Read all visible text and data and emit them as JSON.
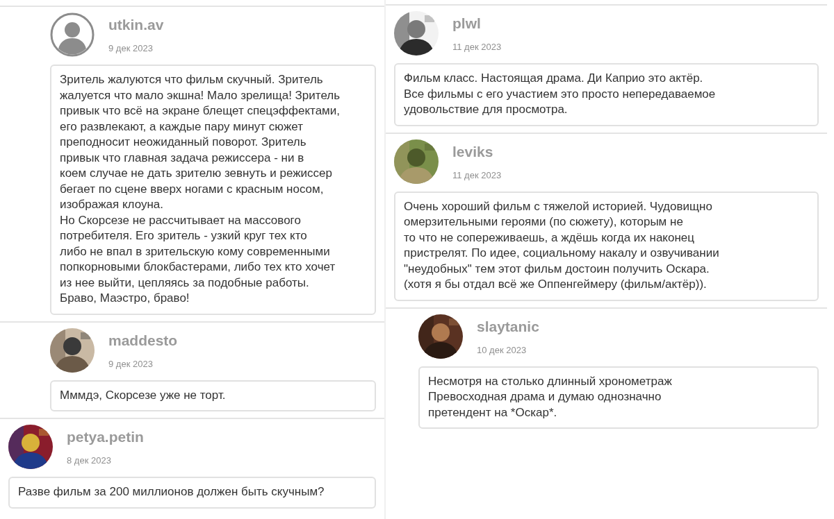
{
  "columns": [
    {
      "comments": [
        {
          "user": "utkin.av",
          "date": "9 дек 2023",
          "reply": true,
          "avatar": {
            "kind": "default"
          },
          "text": "Зритель жалуются что фильм скучный. Зритель\nжалуется что мало экшна! Мало зрелища! Зритель\nпривык что всё на экране блещет спецэффектами,\nего развлекают, а каждые пару минут сюжет\nпреподносит неожиданный поворот. Зритель\nпривык что главная задача режиссера - ни в\nкоем случае не дать зрителю зевнуть и режиссер\nбегает по сцене вверх ногами с красным носом,\nизображая клоуна.\nНо Скорсезе не рассчитывает на массового\nпотребителя. Его зритель - узкий круг тех кто\nлибо не впал в зрительскую кому современными\nпопкорновыми блокбастерами, либо тех кто хочет\nиз нее выйти, цепляясь за подобные работы.\nБраво, Маэстро, браво!"
        },
        {
          "user": "maddesto",
          "date": "9 дек 2023",
          "reply": true,
          "text": "Мммдэ, Скорсезе уже не торт."
        },
        {
          "user": "petya.petin",
          "date": "8 дек 2023",
          "reply": false,
          "text": "Разве фильм за 200 миллионов должен быть скучным?"
        }
      ]
    },
    {
      "comments": [
        {
          "user": "plwl",
          "date": "11 дек 2023",
          "reply": false,
          "text": "Фильм класс. Настоящая драма. Ди Каприо это актёр.\nВсе фильмы с его участием это просто непередаваемое\nудовольствие для просмотра."
        },
        {
          "user": "leviks",
          "date": "11 дек 2023",
          "reply": false,
          "text": "Очень хороший фильм с тяжелой историей. Чудовищно\nомерзительными героями (по сюжету), которым не\nто что не сопереживаешь, а ждёшь когда их наконец\nпристрелят. По идее, социальному накалу и озвучивании\n\"неудобных\" тем этот фильм достоин получить Оскара.\n(хотя я бы отдал всё же Оппенгеймеру (фильм/актёр))."
        },
        {
          "user": "slaytanic",
          "date": "10 дек 2023",
          "reply": true,
          "text": "Несмотря на столько длинный хронометраж\nПревосходная драма и думаю однозначно\nпретендент на *Оскар*."
        }
      ]
    }
  ]
}
